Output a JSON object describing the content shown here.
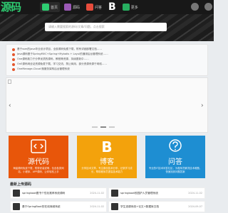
{
  "header": {
    "logo": "源码",
    "nav": [
      {
        "label": "首页",
        "icon": "home-icon",
        "color": "#2ecc71",
        "active": true
      },
      {
        "label": "源码",
        "icon": "code-icon",
        "color": "#9b59b6",
        "active": false
      },
      {
        "label": "问答",
        "icon": "question-icon",
        "color": "#e74c3c",
        "active": false
      },
      {
        "label": "B",
        "icon": "blog-icon",
        "color": "#ffffff",
        "active": false
      },
      {
        "label": "更多",
        "icon": "more-icon",
        "color": "#27ae60",
        "active": false
      }
    ]
  },
  "search": {
    "placeholder": "请输入需要搜索的源码/文章/问题，点击搜索"
  },
  "notice": [
    "基于ssm的java毕业设计项目，全部源码免费下载，附有详细部署文档……",
    "Java源码基于SpringMVC+Spring+Mybatis + Layui的通用后台管理系统……",
    "One源码致力于分享优质的源码、教程等资源，持续更新中……",
    "OnE源码网全站资源免费下载，学习交流，禁止商用，部分资源来源于网络……",
    "OneManage-Cloud 微服务架构后台管理系统"
  ],
  "banner": {
    "dots": 3,
    "active_dot": 1
  },
  "cards": [
    {
      "title": "源代码",
      "desc": "海量源码免费下载，附带安装说明，包含各类网站、小程序、APP源码，让你轻松上手",
      "icon": "code-bracket-icon",
      "color": "#e8560a"
    },
    {
      "title": "博客",
      "desc": "分享技术文章，专注原创技术分享，记录学习成长，帮助程序员提高技术能力",
      "icon": "blog-b-icon",
      "color": "#f3a20c"
    },
    {
      "title": "问答",
      "desc": "专业的IT技术问答社区，为程序员解决技术难题，快速找到问题答案",
      "icon": "chat-question-icon",
      "color": "#1e8ed2"
    }
  ],
  "latest": {
    "title": "最新上传源码",
    "items": [
      {
        "text": "springboot图书个性化推荐系统源码",
        "date": "2024-11-02"
      },
      {
        "text": "springboot校园护人员管理系统",
        "date": "2024-11-02"
      },
      {
        "text": "基于SpringBoot的在线商城系统",
        "date": "2024-11-02"
      },
      {
        "text": "学生选课系统+论文+数据库文档",
        "date": "2024-09-07"
      }
    ]
  }
}
